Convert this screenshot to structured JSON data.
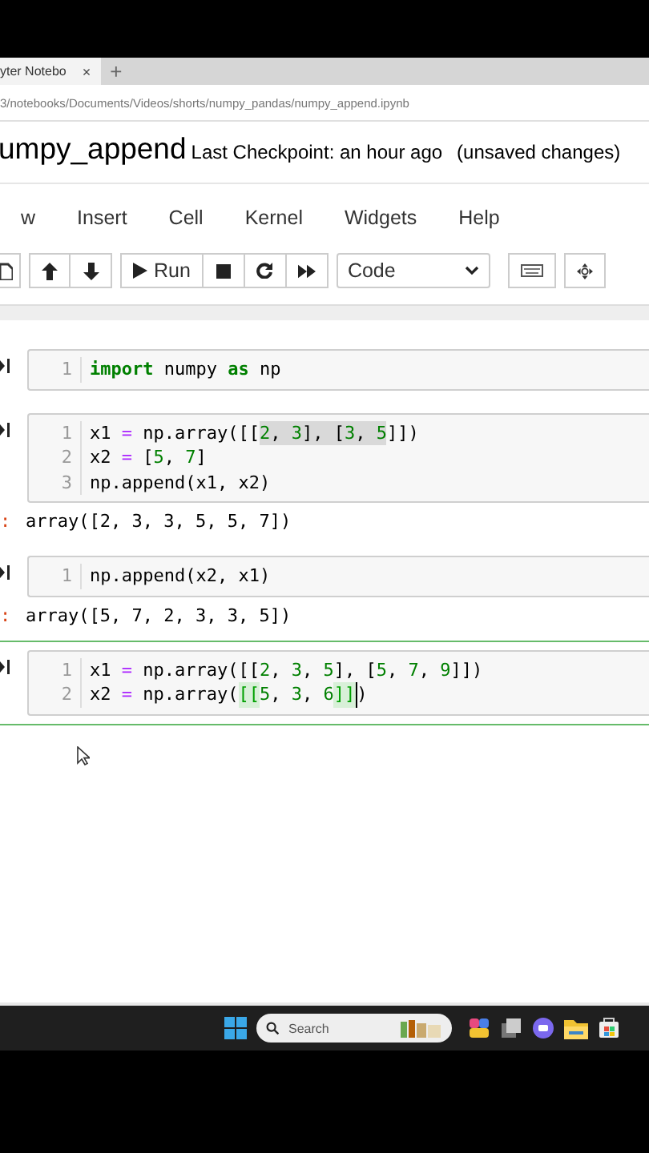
{
  "browser": {
    "tab": {
      "title": "yter Notebo",
      "close": "×"
    },
    "new_tab": "+",
    "url": "3/notebooks/Documents/Videos/shorts/numpy_pandas/numpy_append.ipynb"
  },
  "header": {
    "title": "umpy_append",
    "checkpoint": "Last Checkpoint: an hour ago",
    "status": "(unsaved changes)"
  },
  "menu": [
    "w",
    "Insert",
    "Cell",
    "Kernel",
    "Widgets",
    "Help"
  ],
  "toolbar": {
    "run_label": "Run",
    "cell_type": "Code"
  },
  "cells": [
    {
      "selected": false,
      "lines": [
        {
          "number": "1",
          "tokens": [
            {
              "text": "import",
              "kind": "keyword"
            },
            {
              "text": " numpy ",
              "kind": "plain"
            },
            {
              "text": "as",
              "kind": "keyword"
            },
            {
              "text": " np",
              "kind": "plain"
            }
          ]
        }
      ]
    },
    {
      "selected": false,
      "lines": [
        {
          "number": "1",
          "tokens": [
            {
              "text": "x1 ",
              "kind": "plain"
            },
            {
              "text": "=",
              "kind": "operator"
            },
            {
              "text": " np.array([[",
              "kind": "plain"
            },
            {
              "kind": "group",
              "highlighted": true,
              "tokens": [
                {
                  "text": "2",
                  "kind": "number"
                },
                {
                  "text": ", ",
                  "kind": "plain"
                },
                {
                  "text": "3",
                  "kind": "number"
                },
                {
                  "text": "], [",
                  "kind": "plain"
                },
                {
                  "text": "3",
                  "kind": "number"
                },
                {
                  "text": ", ",
                  "kind": "plain"
                },
                {
                  "text": "5",
                  "kind": "number"
                }
              ]
            },
            {
              "text": "]])",
              "kind": "plain"
            }
          ]
        },
        {
          "number": "2",
          "tokens": [
            {
              "text": "x2 ",
              "kind": "plain"
            },
            {
              "text": "=",
              "kind": "operator"
            },
            {
              "text": " [",
              "kind": "plain"
            },
            {
              "text": "5",
              "kind": "number"
            },
            {
              "text": ", ",
              "kind": "plain"
            },
            {
              "text": "7",
              "kind": "number"
            },
            {
              "text": "]",
              "kind": "plain"
            }
          ]
        },
        {
          "number": "3",
          "tokens": [
            {
              "text": "np.append(x1, x2)",
              "kind": "plain"
            }
          ]
        }
      ],
      "output": {
        "prompt": ":",
        "text": "array([2, 3, 3, 5, 5, 7])"
      }
    },
    {
      "selected": false,
      "lines": [
        {
          "number": "1",
          "tokens": [
            {
              "text": "np.append(x2, x1)",
              "kind": "plain"
            }
          ]
        }
      ],
      "output": {
        "prompt": ":",
        "text": "array([5, 7, 2, 3, 3, 5])"
      }
    },
    {
      "selected": true,
      "lines": [
        {
          "number": "1",
          "tokens": [
            {
              "text": "x1 ",
              "kind": "plain"
            },
            {
              "text": "=",
              "kind": "operator"
            },
            {
              "text": " np.array([[",
              "kind": "plain"
            },
            {
              "text": "2",
              "kind": "number"
            },
            {
              "text": ", ",
              "kind": "plain"
            },
            {
              "text": "3",
              "kind": "number"
            },
            {
              "text": ", ",
              "kind": "plain"
            },
            {
              "text": "5",
              "kind": "number"
            },
            {
              "text": "], [",
              "kind": "plain"
            },
            {
              "text": "5",
              "kind": "number"
            },
            {
              "text": ", ",
              "kind": "plain"
            },
            {
              "text": "7",
              "kind": "number"
            },
            {
              "text": ", ",
              "kind": "plain"
            },
            {
              "text": "9",
              "kind": "number"
            },
            {
              "text": "]])",
              "kind": "plain"
            }
          ]
        },
        {
          "number": "2",
          "tokens": [
            {
              "text": "x2 ",
              "kind": "plain"
            },
            {
              "text": "=",
              "kind": "operator"
            },
            {
              "text": " np.array(",
              "kind": "plain"
            },
            {
              "text": "[[",
              "kind": "match"
            },
            {
              "text": "5",
              "kind": "number"
            },
            {
              "text": ", ",
              "kind": "plain"
            },
            {
              "text": "3",
              "kind": "number"
            },
            {
              "text": ", ",
              "kind": "plain"
            },
            {
              "text": "6",
              "kind": "number"
            },
            {
              "text": "]]",
              "kind": "match"
            },
            {
              "text": ")",
              "kind": "plain",
              "cursor_before": true
            }
          ]
        }
      ]
    }
  ],
  "taskbar": {
    "search_placeholder": "Search"
  }
}
